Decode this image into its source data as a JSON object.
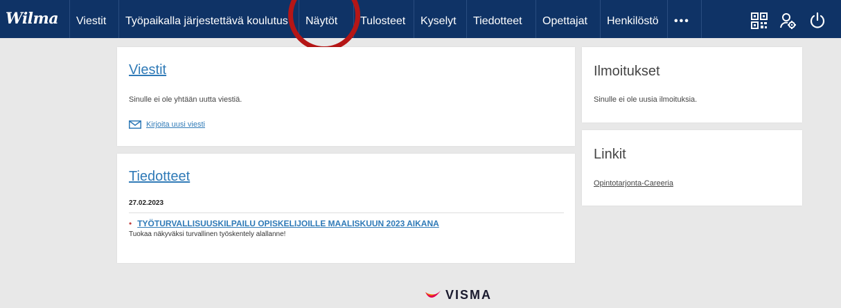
{
  "brand": "Wilma",
  "nav": {
    "items": [
      "Viestit",
      "Työpaikalla järjestettävä koulutus",
      "Näytöt",
      "Tulosteet",
      "Kyselyt",
      "Tiedotteet",
      "Opettajat",
      "Henkilöstö"
    ],
    "more": "•••"
  },
  "icons": {
    "qr": "qr-code-icon",
    "user_settings": "user-settings-icon",
    "power": "power-icon"
  },
  "messages_card": {
    "title": "Viestit",
    "text": "Sinulle ei ole yhtään uutta viestiä.",
    "compose_link": "Kirjoita uusi viesti"
  },
  "news_card": {
    "title": "Tiedotteet",
    "date": "27.02.2023",
    "headline": "TYÖTURVALLISUUSKILPAILU OPISKELIJOILLE MAALISKUUN 2023 AIKANA",
    "description": "Tuokaa näkyväksi turvallinen työskentely alallanne!"
  },
  "notifications_card": {
    "title": "Ilmoitukset",
    "text": "Sinulle ei ole uusia ilmoituksia."
  },
  "links_card": {
    "title": "Linkit",
    "link": "Opintotarjonta-Careeria"
  },
  "footer": {
    "logo_text": "VISMA"
  },
  "colors": {
    "nav_bg": "#0f3366",
    "link": "#2f7ab7",
    "annotation_circle": "#b51616",
    "page_bg": "#e8e8e8"
  }
}
